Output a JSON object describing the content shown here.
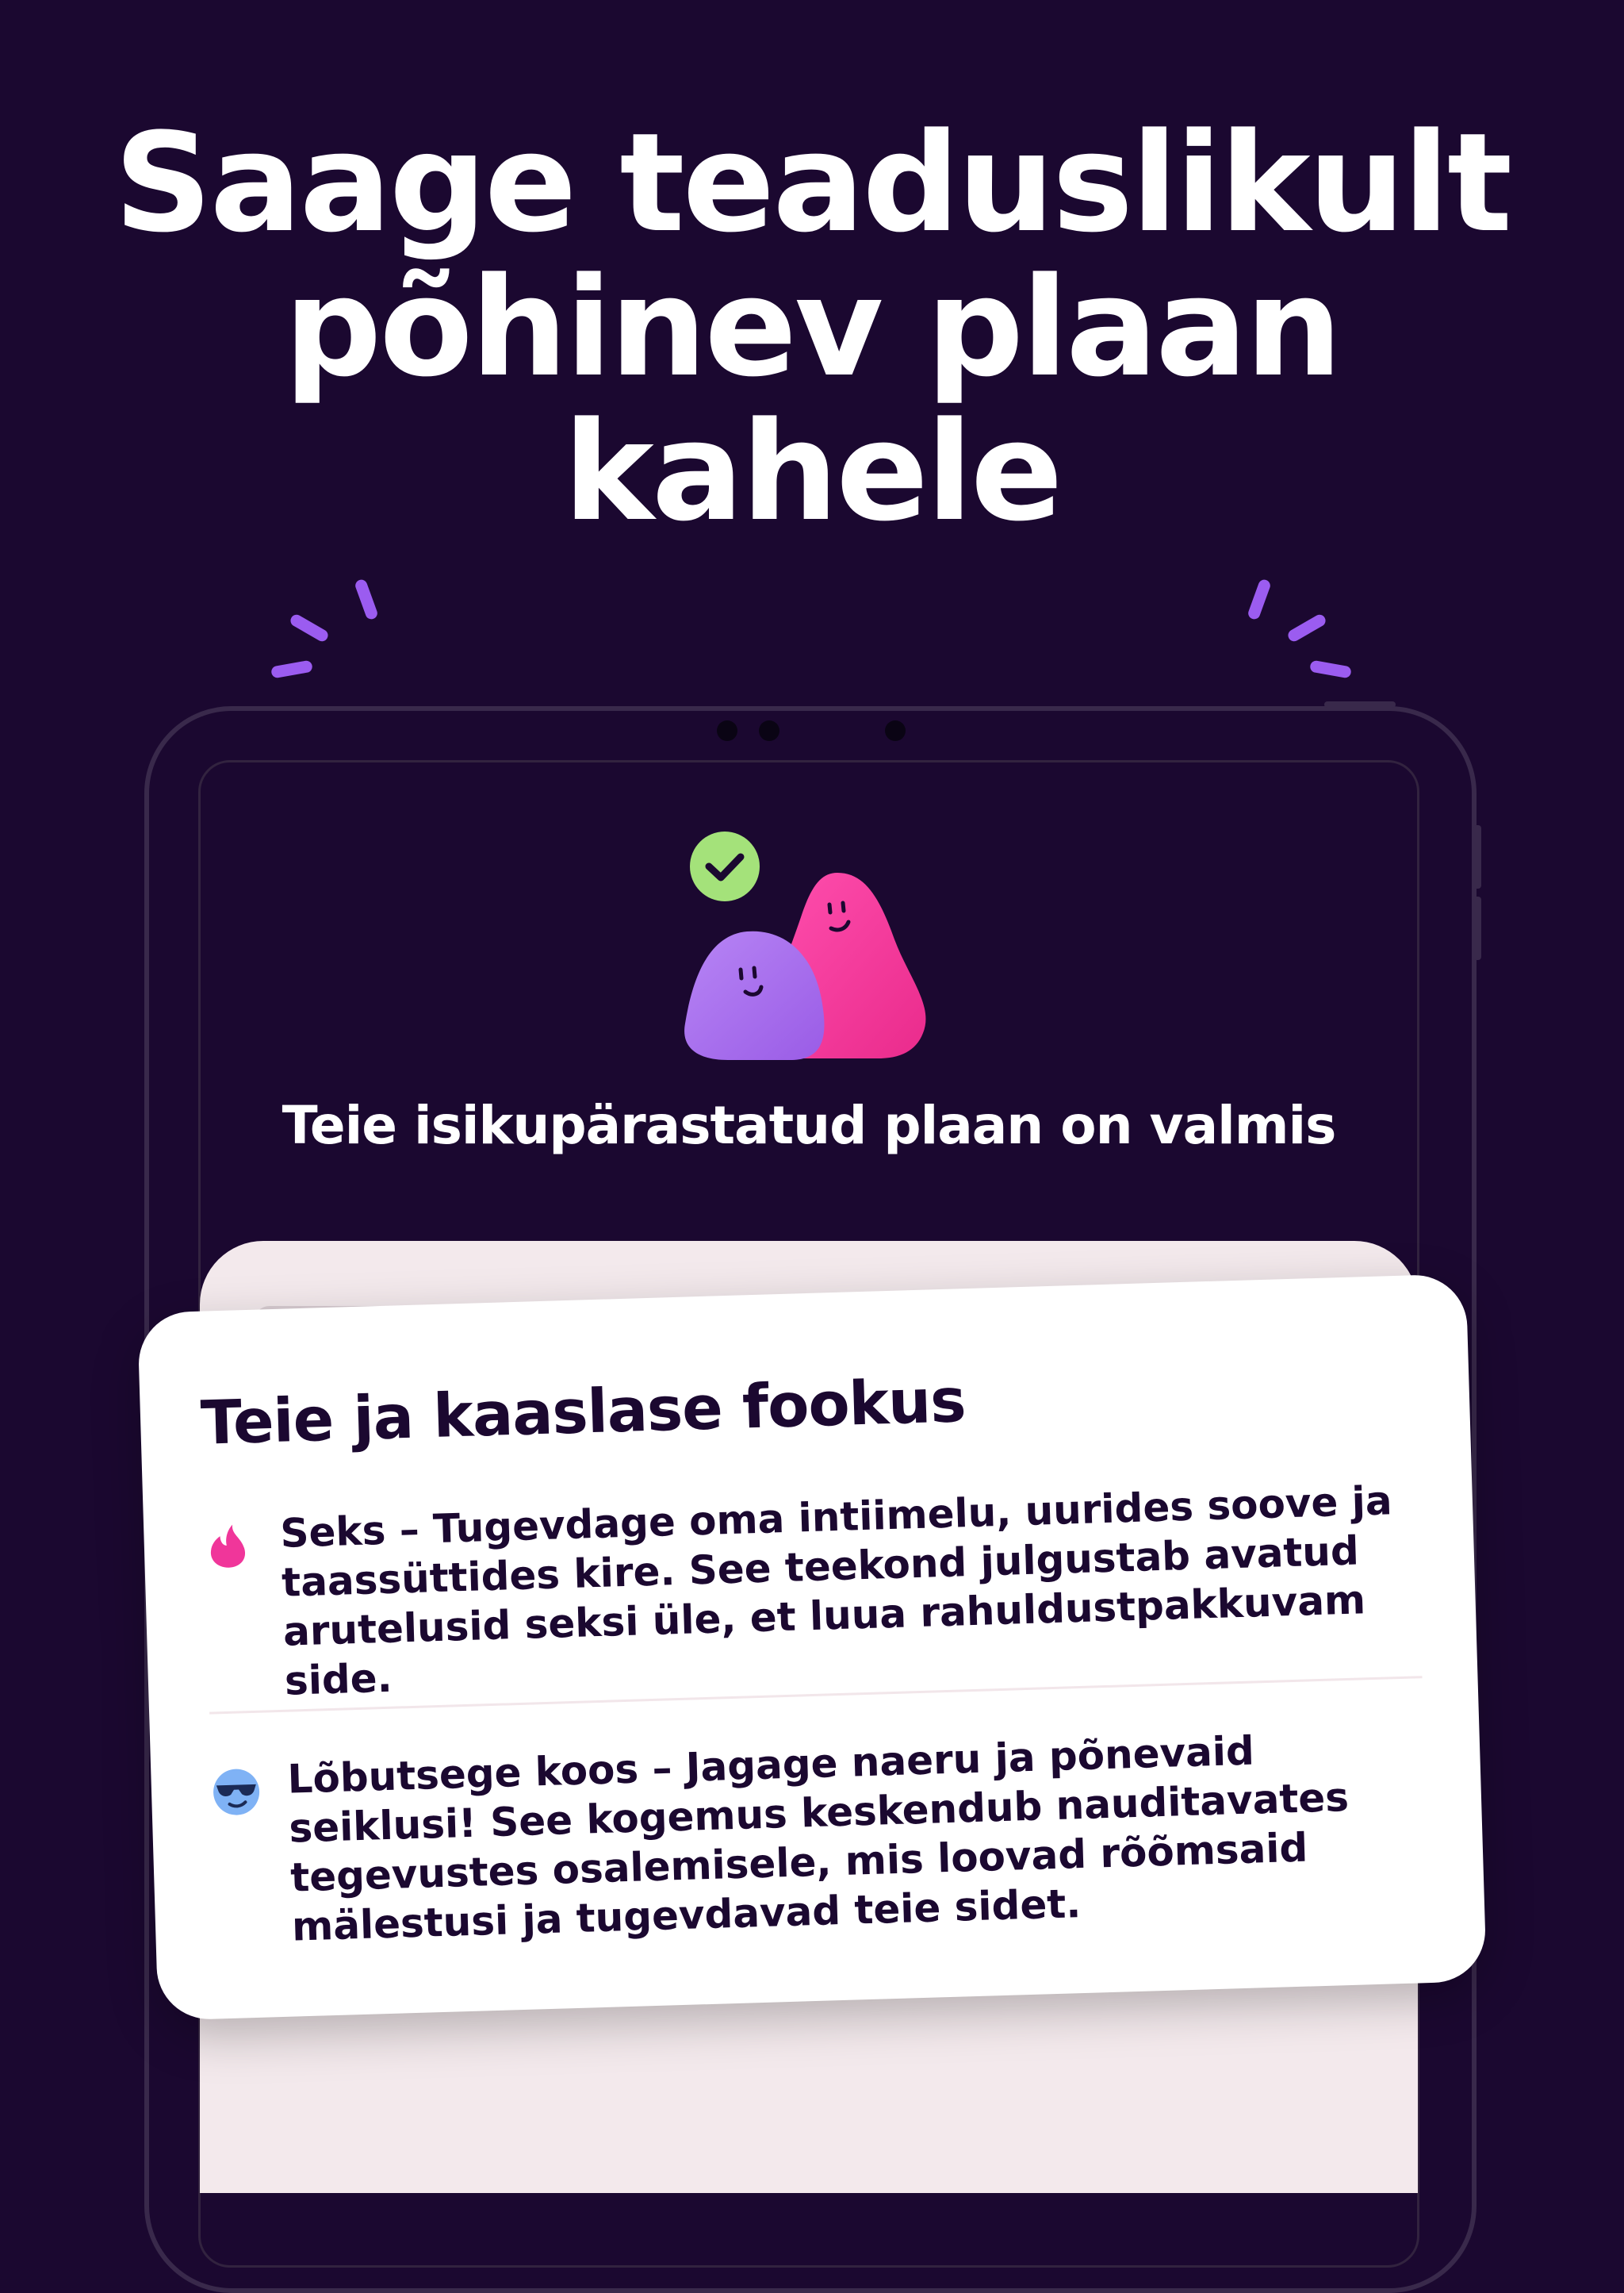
{
  "headline": {
    "line1": "Saage teaduslikult",
    "line2": "põhinev plaan",
    "line3": "kahele"
  },
  "plan_ready_text": "Teie isikupärastatud plaan on valmis",
  "focus_card": {
    "title": "Teie ja kaaslase fookus",
    "items": [
      {
        "icon": "flame-icon",
        "text": "Seks – Tugevdage oma intiimelu, uurides soove ja taassüttides kire. See teekond julgustab avatud arutelusid seksi üle, et luua rahuldustpakkuvam side."
      },
      {
        "icon": "sunglasses-face-icon",
        "text": "Lõbutsege koos – Jagage naeru ja põnevaid seiklusi! See kogemus keskendub nauditavates tegevustes osalemisele, mis loovad rõõmsaid mälestusi ja tugevdavad teie sidet."
      }
    ]
  },
  "colors": {
    "background": "#1b0830",
    "accent_purple": "#9b5cf0",
    "accent_pink": "#f0369a",
    "check_green": "#a4e27a",
    "card_text": "#1b0830"
  }
}
